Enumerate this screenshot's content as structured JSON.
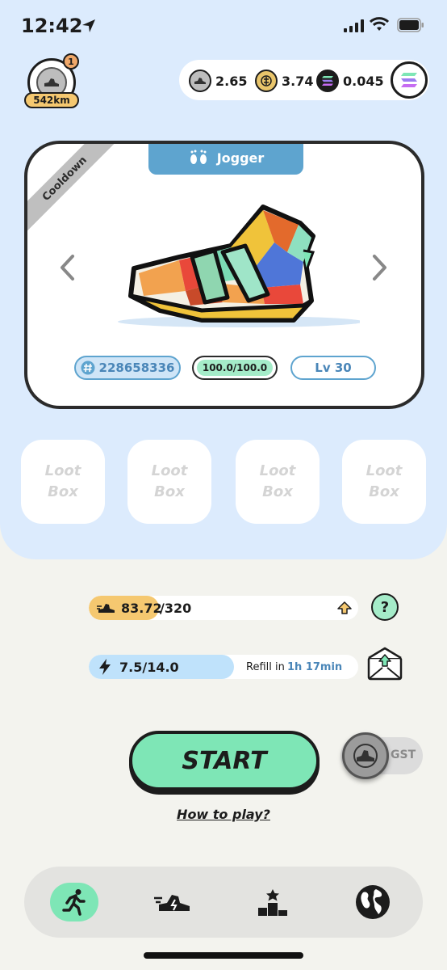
{
  "status_bar": {
    "time": "12:42"
  },
  "profile": {
    "notifications": "1",
    "distance": "542km"
  },
  "currency": {
    "gst": {
      "icon": "gst-coin-icon",
      "value": "2.65"
    },
    "gmt": {
      "icon": "gmt-coin-icon",
      "value": "3.74"
    },
    "sol": {
      "icon": "solana-icon",
      "value": "0.045"
    }
  },
  "sneaker": {
    "status_ribbon": "Cooldown",
    "type": "Jogger",
    "id": "228658336",
    "durability": "100.0/100.0",
    "level": "Lv 30"
  },
  "loot_boxes": [
    "Loot Box",
    "Loot Box",
    "Loot Box",
    "Loot Box"
  ],
  "stats": {
    "mileage": {
      "current": "83.72",
      "separator_max": "/320",
      "progress": 0.26
    },
    "energy": {
      "value": "7.5/14.0",
      "refill_prefix": "Refill in",
      "refill_time": "1h 17min",
      "progress": 0.54
    }
  },
  "actions": {
    "start_label": "START",
    "gst_toggle_label": "GST",
    "how_to_play": "How to play?"
  },
  "nav": [
    "run-icon",
    "sneaker-icon",
    "leaderboard-icon",
    "globe-icon"
  ],
  "colors": {
    "accent_green": "#7ee6b6",
    "accent_blue": "#5ea4cf",
    "mileage_orange": "#f5c870",
    "energy_blue": "#bfe2fb",
    "background_top": "#dcebfd"
  }
}
